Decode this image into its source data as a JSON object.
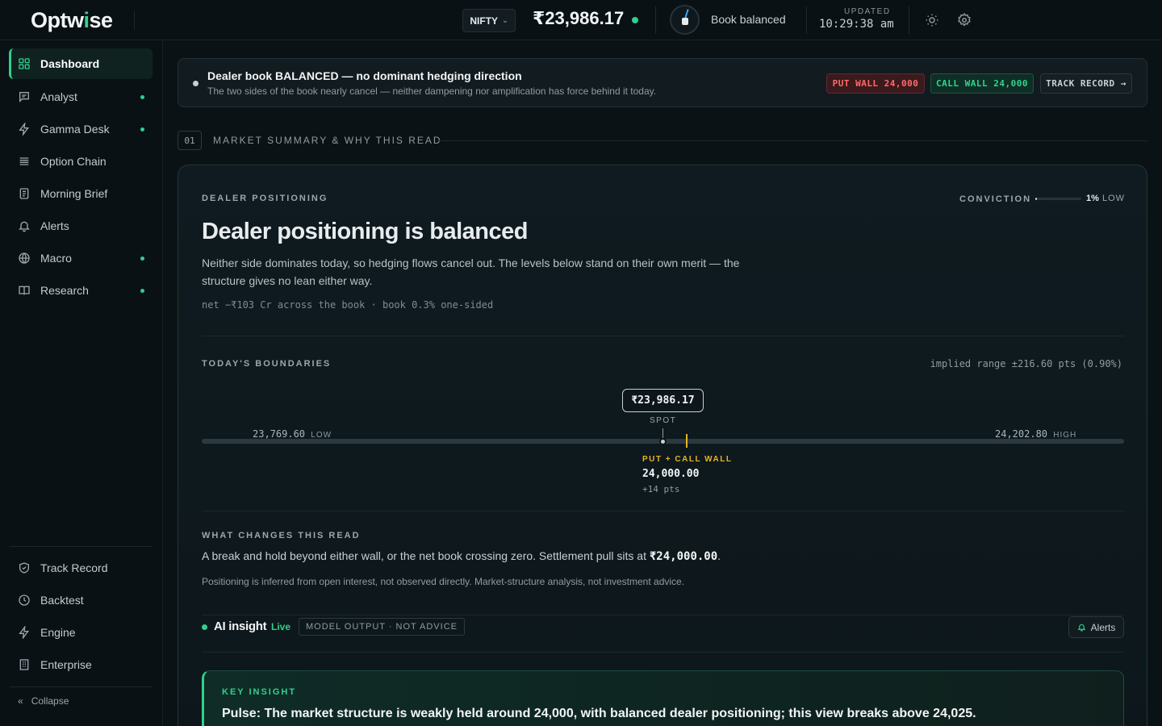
{
  "header": {
    "logo_pre": "Optw",
    "logo_accent": "i",
    "logo_post": "se",
    "ticker": "NIFTY",
    "spot_price": "₹23,986.17",
    "book_state": "Book balanced",
    "updated_label": "UPDATED",
    "updated_time": "10:29:38 am",
    "icons": [
      "sun-icon",
      "gear-icon"
    ]
  },
  "sidebar": {
    "items": [
      {
        "label": "Dashboard",
        "icon": "grid-icon",
        "active": true,
        "dot": false
      },
      {
        "label": "Analyst",
        "icon": "chat-icon",
        "active": false,
        "dot": true
      },
      {
        "label": "Gamma Desk",
        "icon": "bolt-icon",
        "active": false,
        "dot": true
      },
      {
        "label": "Option Chain",
        "icon": "list-icon",
        "active": false,
        "dot": false
      },
      {
        "label": "Morning Brief",
        "icon": "document-icon",
        "active": false,
        "dot": false
      },
      {
        "label": "Alerts",
        "icon": "bell-icon",
        "active": false,
        "dot": false
      },
      {
        "label": "Macro",
        "icon": "globe-icon",
        "active": false,
        "dot": true
      },
      {
        "label": "Research",
        "icon": "book-icon",
        "active": false,
        "dot": true
      }
    ],
    "bottom_items": [
      {
        "label": "Track Record",
        "icon": "shield-icon"
      },
      {
        "label": "Backtest",
        "icon": "clock-icon"
      },
      {
        "label": "Engine",
        "icon": "bolt-icon"
      },
      {
        "label": "Enterprise",
        "icon": "building-icon"
      }
    ],
    "collapse_label": "Collapse"
  },
  "banner": {
    "title": "Dealer book BALANCED — no dominant hedging direction",
    "subtitle": "The two sides of the book nearly cancel — neither dampening nor amplification has force behind it today.",
    "put_wall": "PUT WALL 24,000",
    "call_wall": "CALL WALL 24,000",
    "track_record": "TRACK RECORD →"
  },
  "section": {
    "number": "01",
    "title": "MARKET SUMMARY & WHY THIS READ"
  },
  "card": {
    "eyebrow": "DEALER POSITIONING",
    "conviction_label": "CONVICTION",
    "conviction_value": "1%",
    "conviction_fraction": 0.01,
    "conviction_level": "LOW",
    "headline": "Dealer positioning is balanced",
    "description": "Neither side dominates today, so hedging flows cancel out. The levels below stand on their own merit — the structure gives no lean either way.",
    "net_line": "net −₹103 Cr across the book · book 0.3% one-sided",
    "boundaries_label": "TODAY'S BOUNDARIES",
    "implied_range": "implied range ±216.60 pts (0.90%)",
    "spot_value": "₹23,986.17",
    "spot_label": "SPOT",
    "low_value": "23,769.60",
    "low_tag": "LOW",
    "high_value": "24,202.80",
    "high_tag": "HIGH",
    "wall_label": "PUT + CALL WALL",
    "wall_value": "24,000.00",
    "wall_distance": "+14 pts",
    "changes_label": "WHAT CHANGES THIS READ",
    "changes_pre": "A break and hold beyond either wall, or the net book crossing zero. Settlement pull sits at ",
    "changes_value": "₹24,000.00",
    "changes_post": ".",
    "disclaimer": "Positioning is inferred from open interest, not observed directly. Market-structure analysis, not investment advice.",
    "ai_title": "AI insight",
    "ai_live": "Live",
    "ai_badge": "MODEL OUTPUT · NOT ADVICE",
    "alerts_label": "Alerts",
    "insight_label": "KEY INSIGHT",
    "insight_text": "Pulse: The market structure is weakly held around 24,000, with balanced dealer positioning; this view breaks above 24,025."
  },
  "colors": {
    "accent": "#2fd08d",
    "put": "#ff6b6b",
    "wall": "#e6b422"
  }
}
